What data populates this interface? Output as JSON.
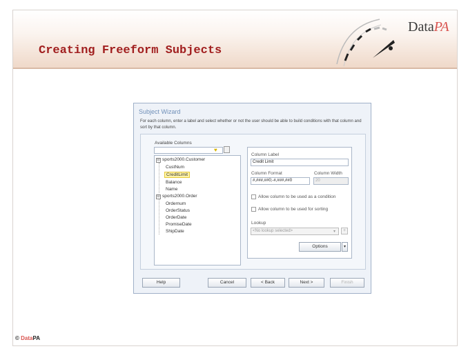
{
  "slide": {
    "title": "Creating Freeform Subjects",
    "logo_text": "Data",
    "logo_accent": "PA",
    "footer_copyright": "©",
    "footer_data": "Data",
    "footer_pa": "PA",
    "accent_color": "#a11f1f"
  },
  "dialog": {
    "title": "Subject Wizard",
    "description": "For each column, enter a label and select whether or not the user should be able to build conditions with that column and sort by that column.",
    "available_columns_label": "Available Columns",
    "tree": [
      {
        "label": "sports2000.Customer",
        "level": 0,
        "expander": "⊟"
      },
      {
        "label": "CustNum",
        "level": 1
      },
      {
        "label": "CreditLimit",
        "level": 1,
        "selected": true
      },
      {
        "label": "Balance",
        "level": 1
      },
      {
        "label": "Name",
        "level": 1
      },
      {
        "label": "sports2000.Order",
        "level": 0,
        "expander": "⊟"
      },
      {
        "label": "Ordernum",
        "level": 1
      },
      {
        "label": "OrderStatus",
        "level": 1
      },
      {
        "label": "OrderDate",
        "level": 1
      },
      {
        "label": "PromiseDate",
        "level": 1
      },
      {
        "label": "ShipDate",
        "level": 1
      }
    ],
    "column_label_caption": "Column Label",
    "column_label_value": "Credit Limit",
    "column_format_caption": "Column Format",
    "column_format_value": "#,###,##0;-#,###,##0",
    "column_width_caption": "Column Width",
    "column_width_value": "20",
    "condition_checkbox_label": "Allow column to be used as a condition",
    "sorting_checkbox_label": "Allow column to be used for sorting",
    "lookup_caption": "Lookup",
    "lookup_value": "<No lookup selected>",
    "options_button": "Options",
    "buttons": {
      "help": "Help",
      "cancel": "Cancel",
      "back": "< Back",
      "next": "Next >",
      "finish": "Finish"
    }
  }
}
